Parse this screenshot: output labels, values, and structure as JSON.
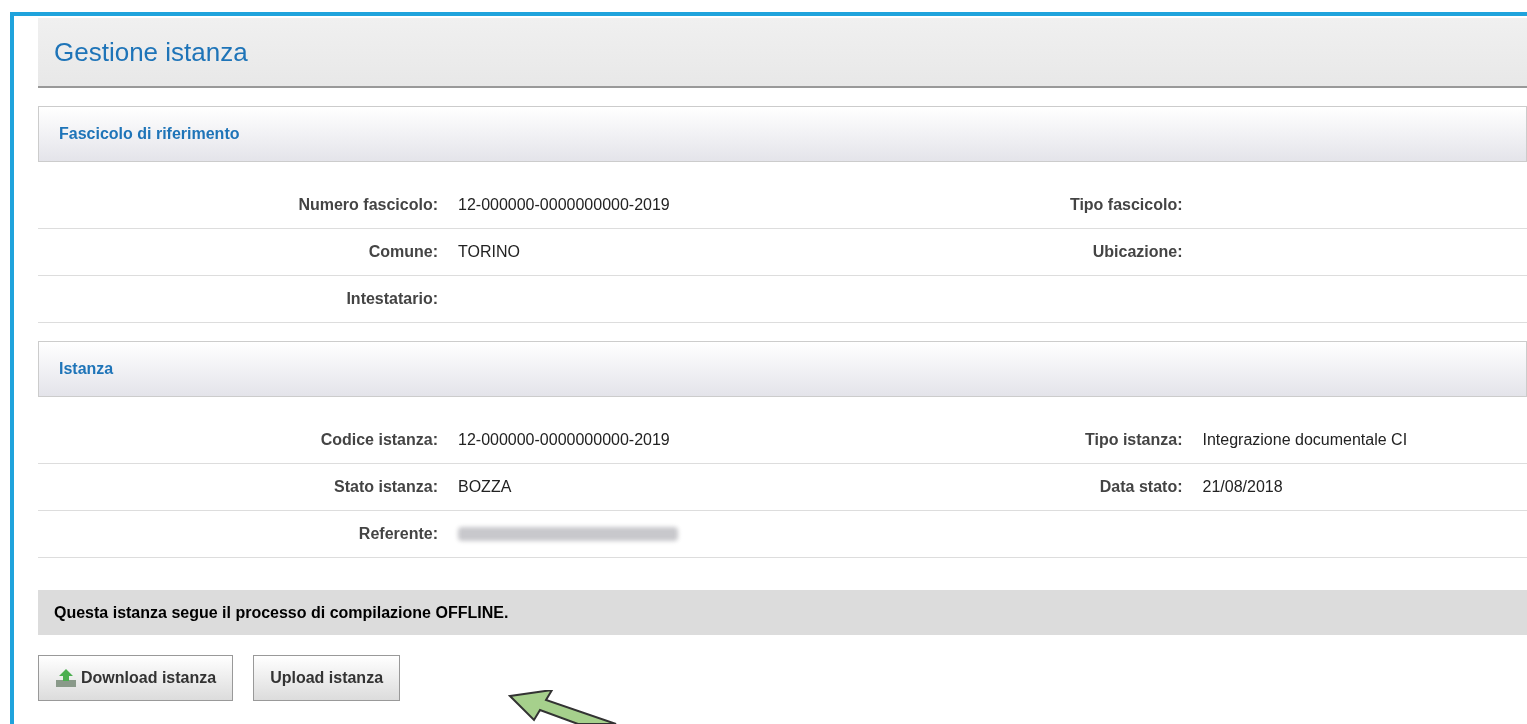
{
  "page_title": "Gestione istanza",
  "sections": [
    {
      "title": "Fascicolo di riferimento",
      "rows": [
        {
          "left": {
            "label": "Numero fascicolo:",
            "value": "12-000000-0000000000-2019"
          },
          "right": {
            "label": "Tipo fascicolo:"
          }
        },
        {
          "left": {
            "label": "Comune:",
            "value": "TORINO"
          },
          "right": {
            "label": "Ubicazione:"
          }
        },
        {
          "left": {
            "label": "Intestatario:"
          }
        }
      ]
    },
    {
      "title": "Istanza",
      "rows": [
        {
          "left": {
            "label": "Codice istanza:",
            "value": "12-000000-0000000000-2019"
          },
          "right": {
            "label": "Tipo istanza:",
            "value": "Integrazione documentale CI"
          }
        },
        {
          "left": {
            "label": "Stato istanza:",
            "value": "BOZZA"
          },
          "right": {
            "label": "Data stato:",
            "value": "21/08/2018"
          }
        },
        {
          "left": {
            "label": "Referente:",
            "redacted": true
          }
        }
      ]
    }
  ],
  "notice": "Questa istanza segue il processo di compilazione OFFLINE.",
  "buttons": [
    {
      "label": "Download istanza",
      "kind": "download"
    },
    {
      "label": "Upload istanza",
      "kind": "plain"
    }
  ]
}
